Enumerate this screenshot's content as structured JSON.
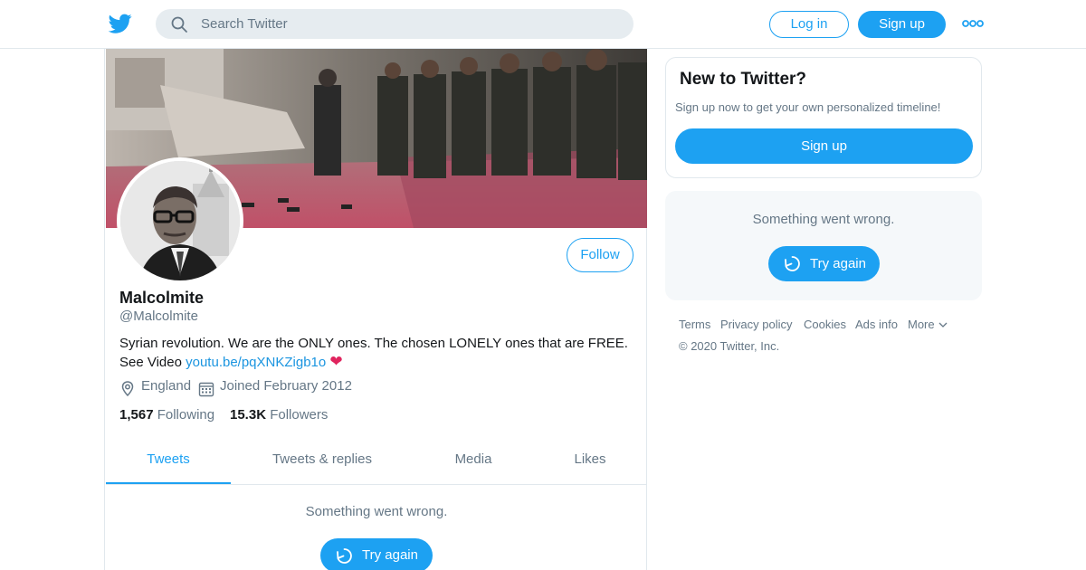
{
  "header": {
    "search_placeholder": "Search Twitter",
    "login_label": "Log in",
    "signup_label": "Sign up",
    "brand_color": "#1da1f2"
  },
  "profile": {
    "name": "Malcolmite",
    "handle": "@Malcolmite",
    "follow_label": "Follow",
    "bio_text": "Syrian revolution. We are the ONLY ones. The chosen LONELY ones that are FREE. See Video ",
    "bio_link": "youtu.be/pqXNKZigb1o",
    "bio_emoji": "❤",
    "location": "England",
    "joined": "Joined February 2012",
    "following_count": "1,567",
    "following_label": "Following",
    "followers_count": "15.3K",
    "followers_label": "Followers"
  },
  "tabs": [
    {
      "label": "Tweets",
      "active": true
    },
    {
      "label": "Tweets & replies",
      "active": false
    },
    {
      "label": "Media",
      "active": false
    },
    {
      "label": "Likes",
      "active": false
    }
  ],
  "timeline": {
    "error_text": "Something went wrong.",
    "retry_label": "Try again"
  },
  "sidebar": {
    "new_title": "New to Twitter?",
    "new_subtitle": "Sign up now to get your own personalized timeline!",
    "new_signup_label": "Sign up",
    "error_text": "Something went wrong.",
    "retry_label": "Try again"
  },
  "footer": {
    "links": [
      "Terms",
      "Privacy policy",
      "Cookies",
      "Ads info",
      "More"
    ],
    "copyright": "© 2020 Twitter, Inc."
  }
}
